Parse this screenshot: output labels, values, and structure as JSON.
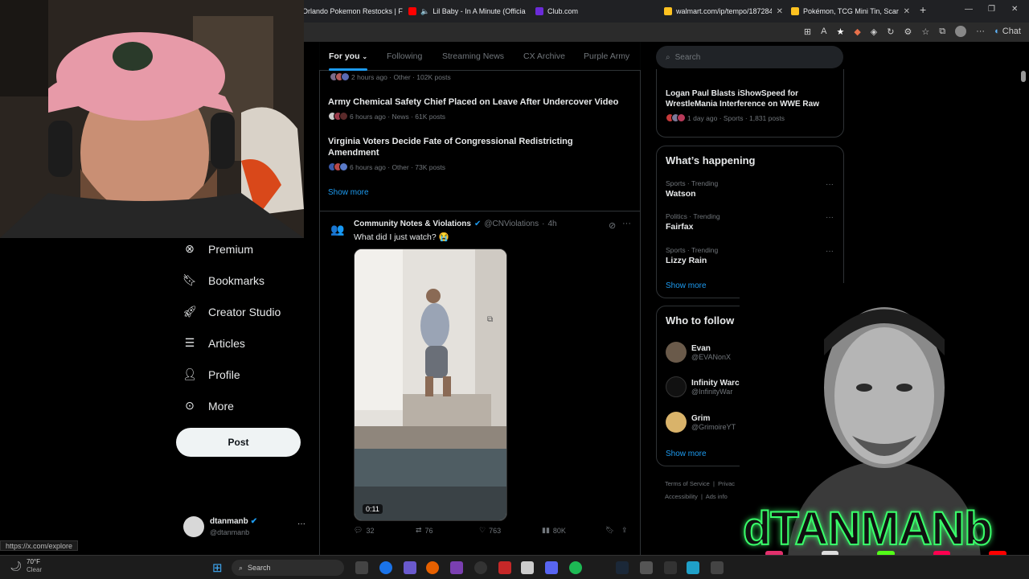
{
  "browser": {
    "tabs": [
      {
        "title": "Orlando Pokemon Restocks | F",
        "favicon_color": "#5865f2"
      },
      {
        "title": "Lil Baby - In A Minute (Officia",
        "favicon_color": "#ff0000"
      },
      {
        "title": "Club.com",
        "favicon_color": "#6b2bd9"
      },
      {
        "title": "walmart.com/ip/tempo/18728422",
        "favicon_color": "#ffc220"
      },
      {
        "title": "Pokémon, TCG Mini Tin, Scarlet &",
        "favicon_color": "#ffc220"
      }
    ],
    "new_tab": "+",
    "chat_label": "Chat",
    "status_url": "https://x.com/explore"
  },
  "timeline": {
    "tabs": [
      "For you",
      "Following",
      "Streaming News",
      "CX Archive",
      "Purple Army"
    ],
    "trends": [
      {
        "meta": "2 hours ago · Other · 102K posts",
        "title": ""
      },
      {
        "title": "Army Chemical Safety Chief Placed on Leave After Undercover Video",
        "meta": "6 hours ago · News · 61K posts"
      },
      {
        "title": "Virginia Voters Decide Fate of Congressional Redistricting Amendment",
        "meta": "6 hours ago · Other · 73K posts"
      }
    ],
    "show_more": "Show more",
    "tweet": {
      "author": "Community Notes & Violations",
      "handle": "@CNViolations",
      "time": "4h",
      "text": "What did I just watch? 😭",
      "video_duration": "0:11",
      "replies": "32",
      "reposts": "76",
      "likes": "763",
      "views": "80K"
    }
  },
  "sidebar_nav": {
    "items": [
      {
        "label": "Premium",
        "icon": "x-premium-icon"
      },
      {
        "label": "Bookmarks",
        "icon": "bookmark-icon"
      },
      {
        "label": "Creator Studio",
        "icon": "rocket-icon"
      },
      {
        "label": "Articles",
        "icon": "article-icon"
      },
      {
        "label": "Profile",
        "icon": "person-icon"
      },
      {
        "label": "More",
        "icon": "more-circle-icon"
      }
    ],
    "post_label": "Post",
    "account": {
      "name": "dtanmanb",
      "handle": "@dtanmanb"
    }
  },
  "right": {
    "search_placeholder": "Search",
    "top_trend": {
      "title": "Logan Paul Blasts iShowSpeed for WrestleMania Interference on WWE Raw",
      "meta": "1 day ago · Sports · 1,831 posts"
    },
    "happening": {
      "title": "What’s happening",
      "items": [
        {
          "context": "Sports · Trending",
          "name": "Watson"
        },
        {
          "context": "Politics · Trending",
          "name": "Fairfax"
        },
        {
          "context": "Sports · Trending",
          "name": "Lizzy Rain"
        }
      ],
      "show_more": "Show more"
    },
    "who_to_follow": {
      "title": "Who to follow",
      "items": [
        {
          "name": "Evan",
          "handle": "@EVANonX"
        },
        {
          "name": "Infinity Warc",
          "handle": "@InfinityWar"
        },
        {
          "name": "Grim",
          "handle": "@GrimoireYT"
        }
      ],
      "show_more": "Show more"
    },
    "footer": [
      "Terms of Service",
      "Privac",
      "Accessibility",
      "Ads info"
    ]
  },
  "overlay": {
    "streamer_name": "dTANMANb"
  },
  "taskbar": {
    "temp": "70°F",
    "weather": "Clear",
    "search": "Search"
  }
}
